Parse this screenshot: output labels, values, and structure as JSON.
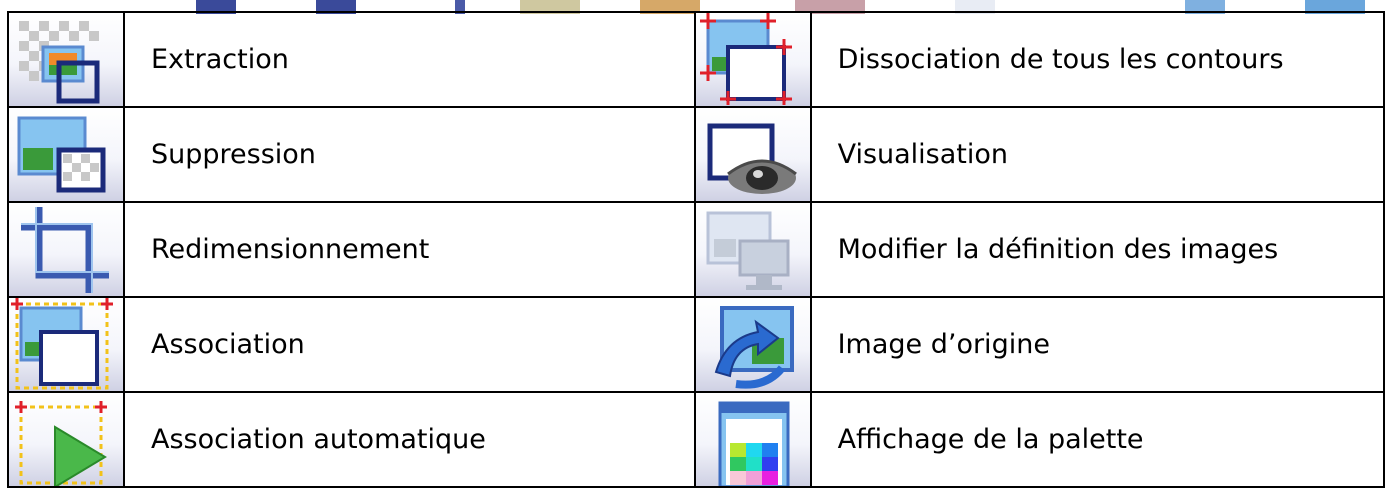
{
  "rows": [
    {
      "left": {
        "icon": "extraction-icon",
        "label": "Extraction"
      },
      "right": {
        "icon": "dissociate-contours-icon",
        "label": "Dissociation de tous les contours"
      }
    },
    {
      "left": {
        "icon": "suppression-icon",
        "label": "Suppression"
      },
      "right": {
        "icon": "eye-visualisation-icon",
        "label": "Visualisation"
      }
    },
    {
      "left": {
        "icon": "crop-resize-icon",
        "label": "Redimensionnement"
      },
      "right": {
        "icon": "change-resolution-icon",
        "label": "Modifier la définition des images"
      }
    },
    {
      "left": {
        "icon": "association-icon",
        "label": "Association"
      },
      "right": {
        "icon": "original-image-icon",
        "label": "Image d’origine"
      }
    },
    {
      "left": {
        "icon": "auto-association-icon",
        "label": "Association automatique"
      },
      "right": {
        "icon": "palette-icon",
        "label": "Affichage de la palette"
      }
    }
  ],
  "colors": {
    "border": "#000000",
    "icon_navy": "#1b2a7a",
    "icon_sky": "#86c4f0",
    "icon_green": "#3a9a3a",
    "handle_red": "#e0202a",
    "handle_yellow": "#f2c21a"
  }
}
